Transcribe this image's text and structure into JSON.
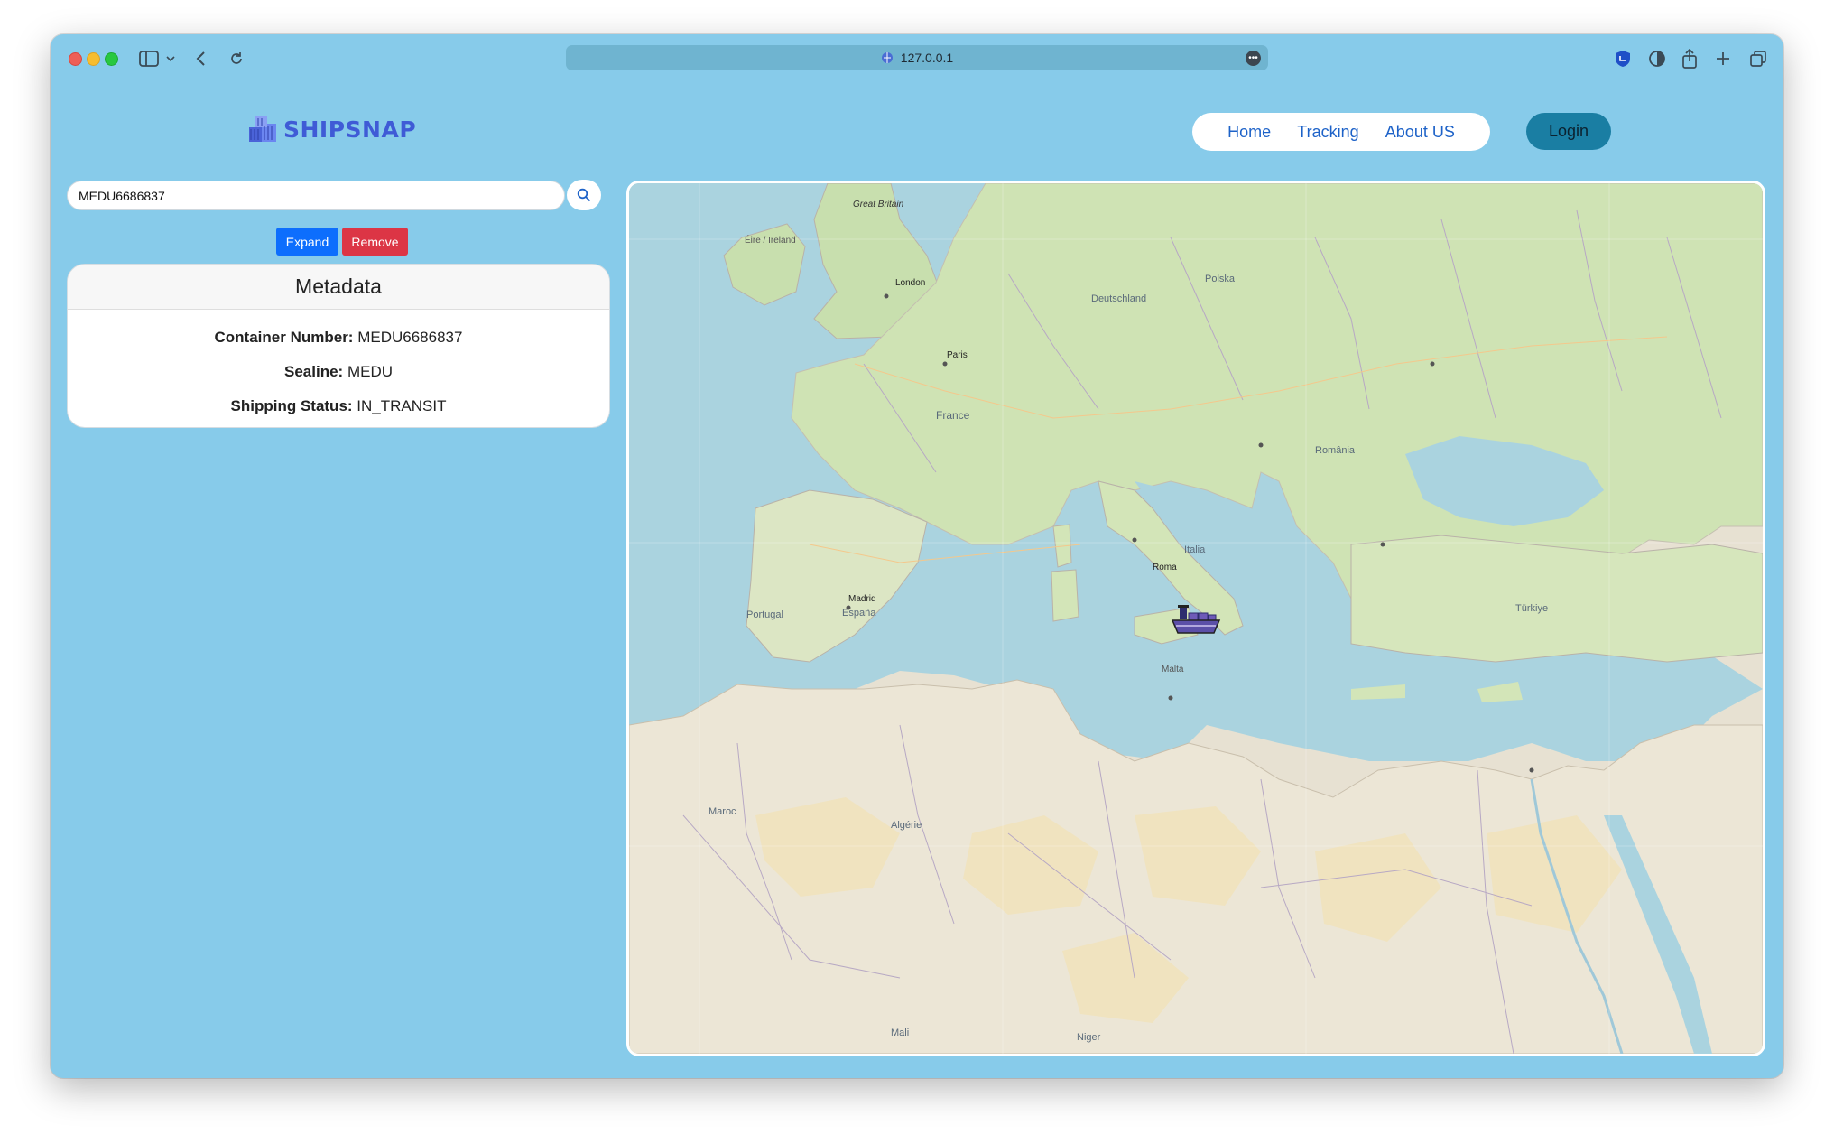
{
  "browser": {
    "url": "127.0.0.1"
  },
  "brand": {
    "name": "SHIPSNAP"
  },
  "nav": {
    "home": "Home",
    "tracking": "Tracking",
    "about": "About US",
    "login": "Login"
  },
  "search": {
    "value": "MEDU6686837"
  },
  "actions": {
    "expand": "Expand",
    "remove": "Remove"
  },
  "metadata": {
    "title": "Metadata",
    "container_label": "Container Number:",
    "container_value": "MEDU6686837",
    "sealine_label": "Sealine:",
    "sealine_value": "MEDU",
    "status_label": "Shipping Status:",
    "status_value": "IN_TRANSIT"
  },
  "map": {
    "labels": {
      "great_britain": "Great Britain",
      "eire": "Éire / Ireland",
      "france": "France",
      "espana": "España",
      "portugal": "Portugal",
      "italia": "Italia",
      "deutschland": "Deutschland",
      "polska": "Polska",
      "romania": "România",
      "turkiye": "Türkiye",
      "paris": "Paris",
      "london": "London",
      "madrid": "Madrid",
      "roma": "Roma",
      "malta": "Malta",
      "algerie": "Algérie",
      "maroc": "Maroc",
      "niger": "Niger",
      "mali": "Mali"
    },
    "colors": {
      "sea": "#aad3df",
      "land": "#dfe6cf",
      "green": "#c8dfae",
      "desert": "#f0e3bf"
    }
  },
  "colors": {
    "background": "#87cbea",
    "brand": "#3f5bd6",
    "nav_link": "#1d62c8",
    "login": "#1a7ea3",
    "expand": "#0d6efd",
    "remove": "#dc3545"
  }
}
